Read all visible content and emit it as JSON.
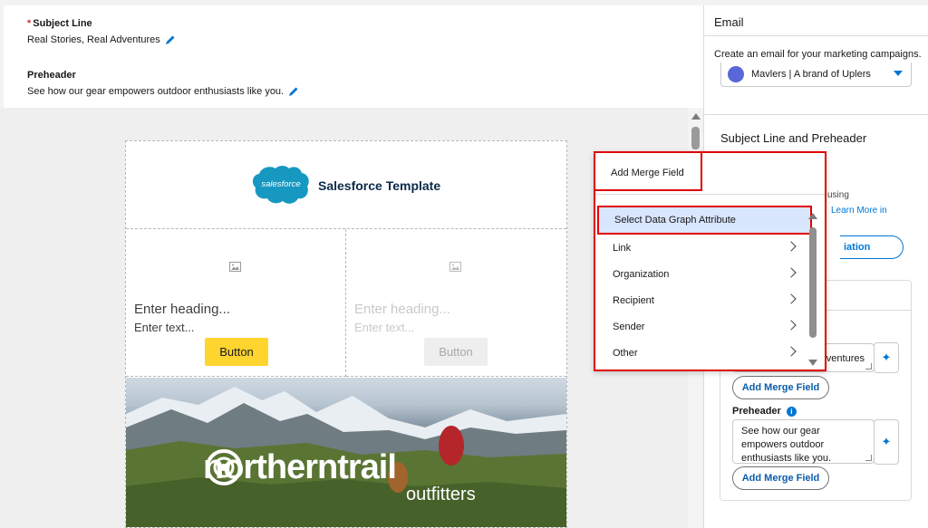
{
  "editor": {
    "subject_label": "Subject Line",
    "required_mark": "*",
    "subject_value": "Real Stories, Real Adventures",
    "preheader_label": "Preheader",
    "preheader_value": "See how our gear empowers outdoor enthusiasts like you."
  },
  "email": {
    "logo_text": "salesforce",
    "template_title": "Salesforce Template",
    "left_column": {
      "heading": "Enter heading...",
      "text": "Enter text...",
      "button": "Button"
    },
    "right_column": {
      "heading": "Enter heading...",
      "text": "Enter text...",
      "button": "Button"
    },
    "hero_brand_word1": "northern",
    "hero_brand_word2": "trail",
    "hero_brand_sub": "outfitters"
  },
  "merge_popover": {
    "title": "Add Merge Field",
    "items": [
      {
        "label": "Select Data Graph Attribute"
      },
      {
        "label": "Link"
      },
      {
        "label": "Organization"
      },
      {
        "label": "Recipient"
      },
      {
        "label": "Sender"
      },
      {
        "label": "Other"
      }
    ]
  },
  "right_panel": {
    "title": "Email",
    "description": "Create an email for your marketing campaigns.",
    "brand_select_value": "Mavlers | A brand of Uplers",
    "section_title": "Subject Line and Preheader",
    "partial_text_1": "using",
    "partial_link": "Learn More in",
    "partial_pill": "iation",
    "subject_textarea_value": "ventures",
    "merge_button_label": "Add Merge Field",
    "preheader_label": "Preheader",
    "info_icon_glyph": "i",
    "preheader_textarea_value": "See how our gear empowers outdoor enthusiasts like you.",
    "ai_icon_glyph": "✦"
  },
  "colors": {
    "accent": "#0176d3",
    "highlight_border": "#e00000",
    "selected_item_bg": "#d8e6fe",
    "button_yellow": "#fed42e",
    "salesforce_blue": "#1798c1"
  }
}
